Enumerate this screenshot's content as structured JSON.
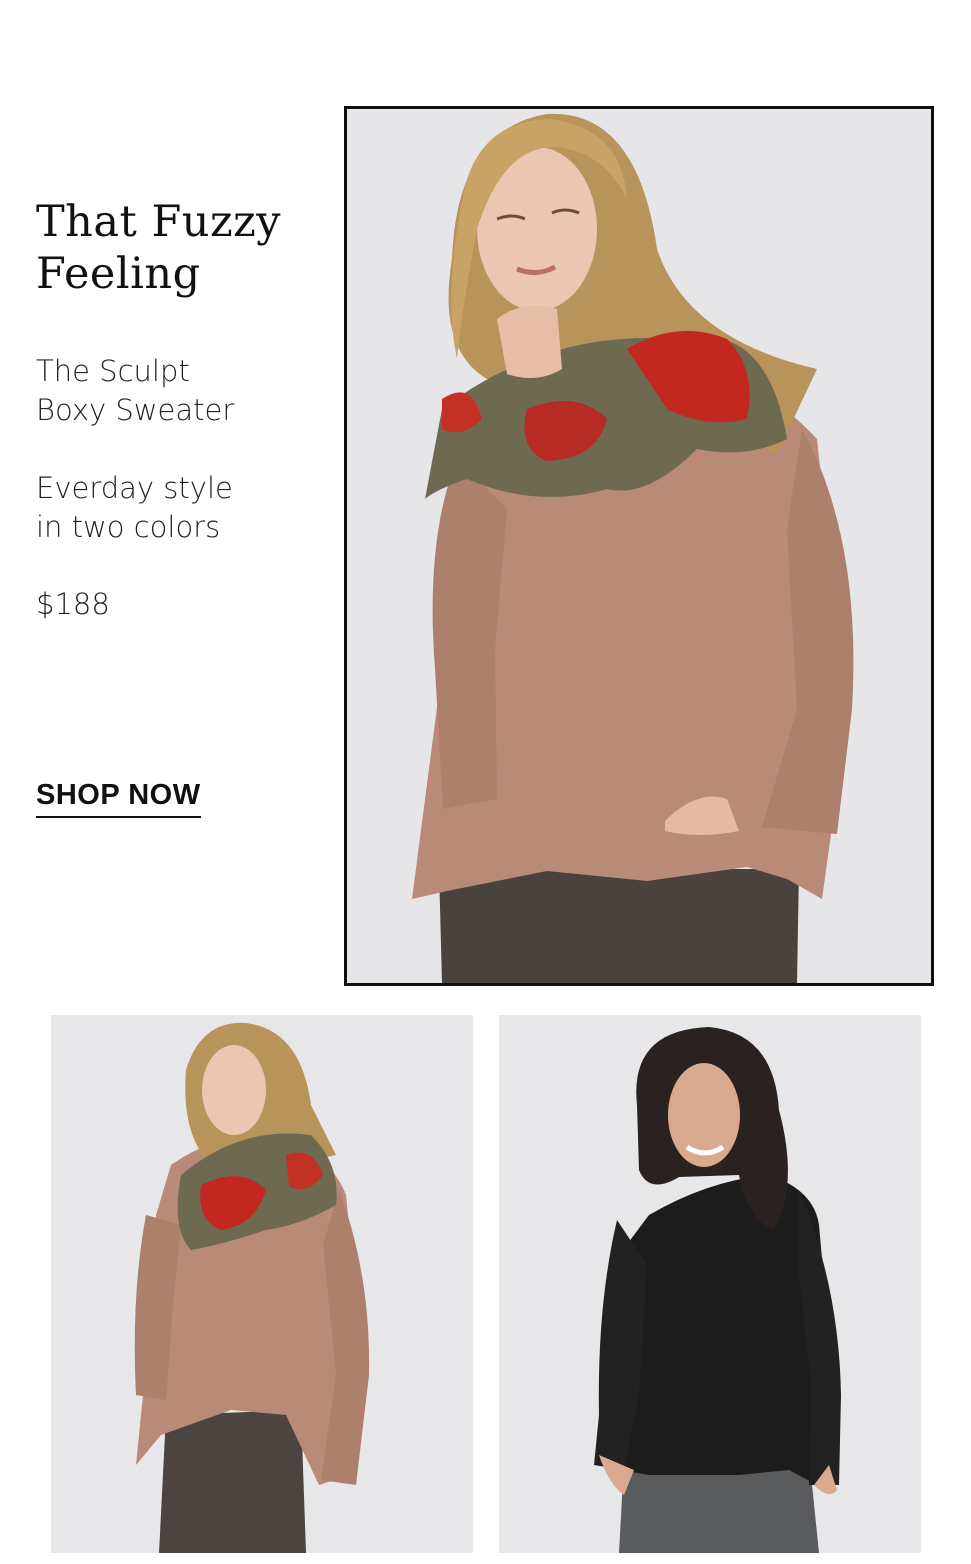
{
  "promo": {
    "headline_lines": [
      "That Fuzzy",
      "Feeling"
    ],
    "product_lines": [
      "The Sculpt",
      "Boxy Sweater"
    ],
    "tagline_lines": [
      "Everday style",
      "in two colors"
    ],
    "price": "$188",
    "cta_label": "SHOP NOW"
  },
  "images": {
    "hero": {
      "subject": "model in blush sweater with floral scarf"
    },
    "thumb_left": {
      "subject": "model in blush sweater, side view"
    },
    "thumb_right": {
      "subject": "model in black sweater"
    }
  },
  "colors": {
    "background": "#ffffff",
    "photo_backdrop": "#e6e6e8",
    "sweater_blush": "#b98a78",
    "sweater_black": "#1c1c1c",
    "frame_border": "#0e0e0e"
  }
}
